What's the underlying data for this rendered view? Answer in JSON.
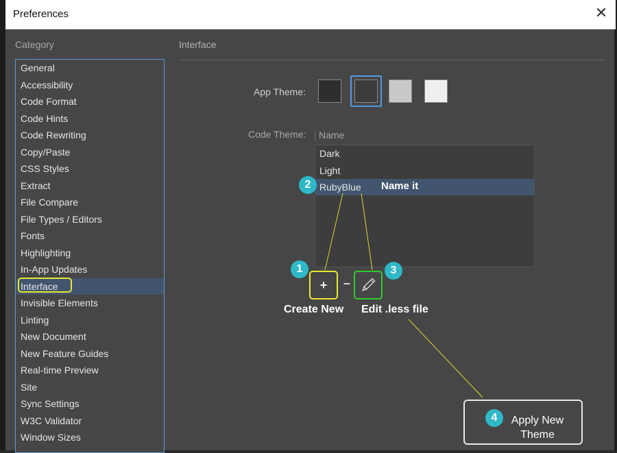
{
  "window": {
    "title": "Preferences",
    "close_glyph": "✕"
  },
  "sidebar": {
    "label": "Category",
    "items": [
      {
        "label": "General"
      },
      {
        "label": "Accessibility"
      },
      {
        "label": "Code Format"
      },
      {
        "label": "Code Hints"
      },
      {
        "label": "Code Rewriting"
      },
      {
        "label": "Copy/Paste"
      },
      {
        "label": "CSS Styles"
      },
      {
        "label": "Extract"
      },
      {
        "label": "File Compare"
      },
      {
        "label": "File Types / Editors"
      },
      {
        "label": "Fonts"
      },
      {
        "label": "Highlighting"
      },
      {
        "label": "In-App Updates"
      },
      {
        "label": "Interface"
      },
      {
        "label": "Invisible Elements"
      },
      {
        "label": "Linting"
      },
      {
        "label": "New Document"
      },
      {
        "label": "New Feature Guides"
      },
      {
        "label": "Real-time Preview"
      },
      {
        "label": "Site"
      },
      {
        "label": "Sync Settings"
      },
      {
        "label": "W3C Validator"
      },
      {
        "label": "Window Sizes"
      }
    ],
    "selected": "Interface"
  },
  "main": {
    "section_title": "Interface",
    "app_theme": {
      "label": "App Theme:",
      "swatches": [
        "#2e2e2e",
        "#3c3c3c",
        "#c9c9c9",
        "#efefef"
      ],
      "selected_index": 1
    },
    "code_theme": {
      "label": "Code Theme:",
      "column_header": "Name",
      "items": [
        {
          "label": "Dark"
        },
        {
          "label": "Light"
        },
        {
          "label": "RubyBlue"
        }
      ],
      "selected": "RubyBlue"
    },
    "buttons": {
      "add_glyph": "+",
      "remove_glyph": "–",
      "edit_icon": "pencil-icon"
    }
  },
  "annotations": {
    "badges": [
      "1",
      "2",
      "3",
      "4"
    ],
    "create_new": "Create New",
    "name_it": "Name it",
    "edit_less": "Edit .less file",
    "apply_line1": "Apply New",
    "apply_line2": "Theme"
  },
  "colors": {
    "accent_blue": "#5b9bd5",
    "selection": "#42556e",
    "yellow_highlight": "#e8e830",
    "green_highlight": "#2ecc2e",
    "badge": "#2fb8c8"
  }
}
